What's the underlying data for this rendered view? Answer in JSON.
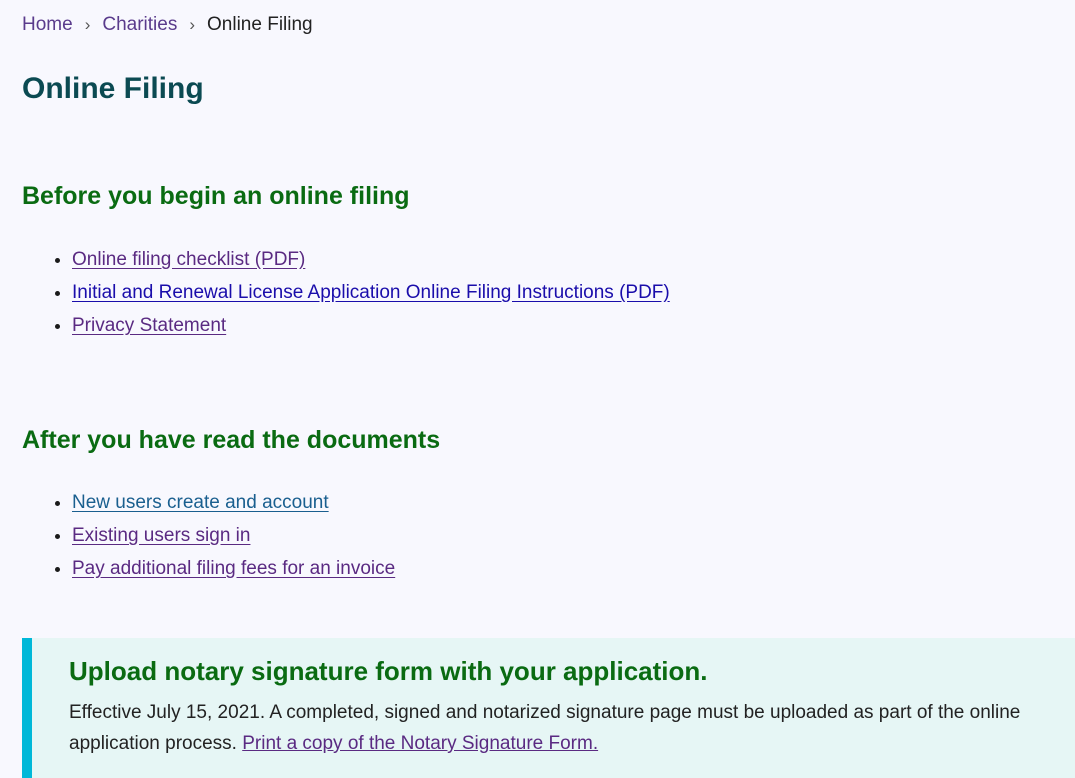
{
  "breadcrumb": {
    "items": [
      {
        "label": "Home"
      },
      {
        "label": "Charities"
      }
    ],
    "current": "Online Filing",
    "separator": "›"
  },
  "page_title": "Online Filing",
  "section_before": {
    "heading": "Before you begin an online filing",
    "links": [
      {
        "label": "Online filing checklist (PDF)"
      },
      {
        "label": "Initial and Renewal License Application Online Filing Instructions (PDF)"
      },
      {
        "label": "Privacy Statement"
      }
    ]
  },
  "section_after": {
    "heading": "After you have read the documents",
    "links": [
      {
        "label": "New users create and account"
      },
      {
        "label": "Existing users sign in"
      },
      {
        "label": "Pay additional filing fees for an invoice"
      }
    ]
  },
  "callout": {
    "heading": "Upload notary signature form with your application.",
    "body": "Effective July 15, 2021. A completed, signed and notarized signature page must be uploaded as part of the online application process.",
    "link": "Print a copy of the Notary Signature Form."
  }
}
